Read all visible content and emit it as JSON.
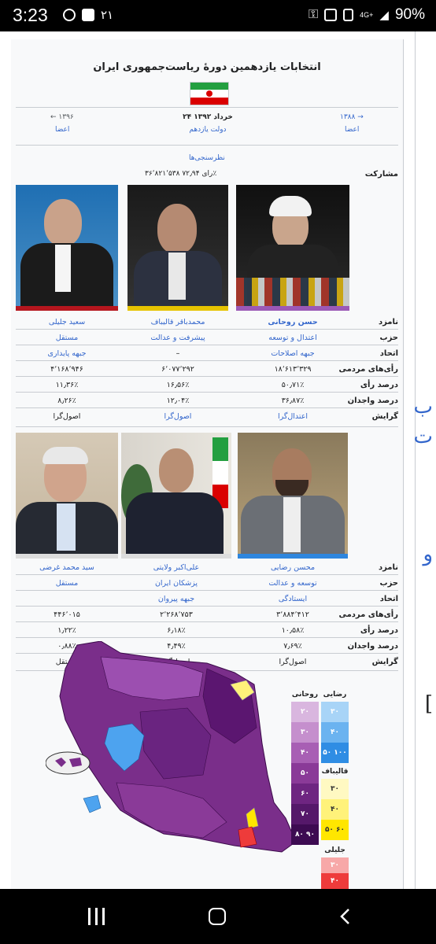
{
  "status_bar": {
    "time": "3:23",
    "notif_count": "۲۱",
    "network": "4G+",
    "battery": "90%"
  },
  "infobox": {
    "title": "انتخابات یازدهمین دورهٔ ریاست‌جمهوری ایران",
    "prev_year": "← ۱۳۹۶",
    "next_year": "۱۳۸۸ →",
    "prev_label": "اعضا",
    "next_label": "اعضا",
    "date": "۲۴ خرداد ۱۳۹۲",
    "govt": "دولت یازدهم",
    "polls_link": "نظرسنجی‌ها",
    "turnout_label": "مشارکت",
    "turnout_value": "۳۶٬۸۲۱٬۵۳۸ رای ۷۲٫۹۴٪",
    "row_labels": {
      "candidate": "نامزد",
      "party": "حزب",
      "alliance": "اتحاد",
      "votes": "رأی‌های مردمی",
      "percent": "درصد رأی",
      "eligible": "درصد واجدان",
      "orientation": "گرایش"
    },
    "group1": [
      {
        "name": "حسن روحانی",
        "party": "اعتدال و توسعه",
        "alliance": "جبهه اصلاحات",
        "votes": "۱۸٬۶۱۳٬۳۲۹",
        "percent": "۵۰٫۷۱٪",
        "eligible": "۳۶٫۸۷٪",
        "orientation": "اعتدال‌گرا",
        "color": "#9b59b6"
      },
      {
        "name": "محمدباقر قالیباف",
        "party": "پیشرفت و عدالت",
        "alliance": "–",
        "votes": "۶٬۰۷۷٬۲۹۲",
        "percent": "۱۶٫۵۶٪",
        "eligible": "۱۲٫۰۴٪",
        "orientation": "اصول‌گرا",
        "color": "#e6c300"
      },
      {
        "name": "سعید جلیلی",
        "party": "مستقل",
        "alliance": "جبهه پایداری",
        "votes": "۴٬۱۶۸٬۹۴۶",
        "percent": "۱۱٫۳۶٪",
        "eligible": "۸٫۲۶٪",
        "orientation": "اصول‌گرا",
        "color": "#b5161e"
      }
    ],
    "group2": [
      {
        "name": "محسن رضایی",
        "party": "توسعه و عدالت",
        "alliance": "ایستادگی",
        "votes": "۳٬۸۸۴٬۴۱۲",
        "percent": "۱۰٫۵۸٪",
        "eligible": "۷٫۶۹٪",
        "orientation": "اصول‌گرا",
        "color": "#2e86de"
      },
      {
        "name": "علی‌اکبر ولایتی",
        "party": "پزشکان ایران",
        "alliance": "جبهه پیروان",
        "votes": "۲٬۲۶۸٬۷۵۳",
        "percent": "۶٫۱۸٪",
        "eligible": "۴٫۴۹٪",
        "orientation": "اصول‌گرا",
        "color": "#dddddd"
      },
      {
        "name": "سید محمد غرضی",
        "party": "مستقل",
        "alliance": "",
        "votes": "۴۴۶٬۰۱۵",
        "percent": "۱٫۲۲٪",
        "eligible": "۰٫۸۸٪",
        "orientation": "مستقل",
        "color": "#dddddd"
      }
    ]
  },
  "map_legend": {
    "rouhani": {
      "label": "روحانی",
      "steps": [
        "۲۰",
        "۳۰",
        "۴۰",
        "۵۰",
        "۶۰",
        "۷۰",
        "۸۰ ۹۰"
      ],
      "colors": [
        "#d9b6df",
        "#c58fcd",
        "#a85fb4",
        "#8a3a98",
        "#6e2581",
        "#55186a",
        "#3d0b52"
      ]
    },
    "rezaei": {
      "label": "رضایی",
      "steps": [
        "۳۰",
        "۴۰",
        "۵۰ ۱۰۰"
      ],
      "colors": [
        "#a8d4f7",
        "#6bb3f0",
        "#2f8de4"
      ]
    },
    "ghalibaf": {
      "label": "قالیباف",
      "steps": [
        "۳۰",
        "۴۰",
        "۵۰ ۶۰"
      ],
      "colors": [
        "#fff9c2",
        "#fff27a",
        "#ffe600"
      ]
    },
    "jalili": {
      "label": "جلیلی",
      "steps": [
        "۳۰",
        "۴۰"
      ],
      "colors": [
        "#f7a8a8",
        "#ee3b3b"
      ]
    }
  },
  "page_edge_chars": [
    "ب",
    "ت",
    "و",
    "["
  ]
}
